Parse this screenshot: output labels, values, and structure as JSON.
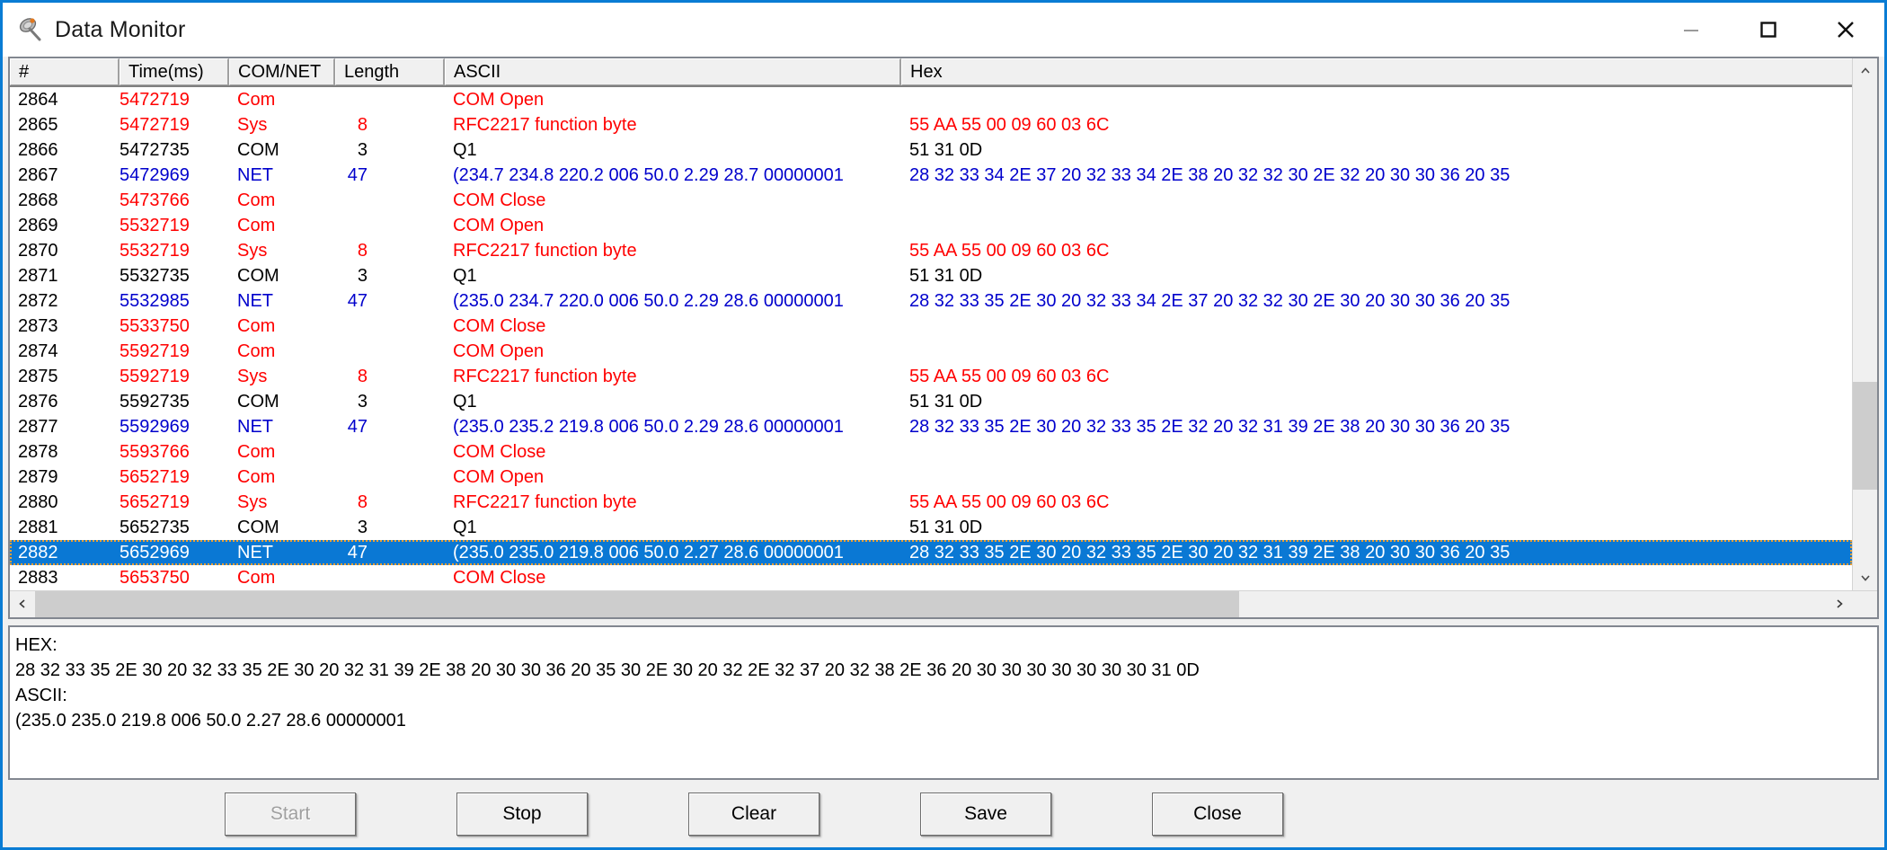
{
  "window": {
    "title": "Data Monitor",
    "icon": "satellite-dish-icon",
    "accent_color": "#0a7cd4",
    "controls": {
      "minimize": "minimize-icon",
      "maximize": "maximize-icon",
      "close": "close-icon"
    }
  },
  "colors": {
    "com_red": "#ff0000",
    "net_blue": "#0000cc",
    "normal_black": "#000000",
    "selection_blue": "#0a78d4",
    "focus_outline": "#f0a030"
  },
  "table": {
    "columns": [
      {
        "key": "num",
        "label": "#"
      },
      {
        "key": "time",
        "label": "Time(ms)"
      },
      {
        "key": "type",
        "label": "COM/NET"
      },
      {
        "key": "len",
        "label": "Length"
      },
      {
        "key": "ascii",
        "label": "ASCII"
      },
      {
        "key": "hex",
        "label": "Hex"
      }
    ],
    "rows": [
      {
        "num": "2864",
        "time": "5472719",
        "type": "Com",
        "len": "",
        "ascii": "COM Open",
        "hex": "",
        "color": "red",
        "selected": false
      },
      {
        "num": "2865",
        "time": "5472719",
        "type": "Sys",
        "len": "8",
        "ascii": "RFC2217 function byte",
        "hex": "55 AA 55 00 09 60 03 6C",
        "color": "red",
        "selected": false
      },
      {
        "num": "2866",
        "time": "5472735",
        "type": "COM",
        "len": "3",
        "ascii": "Q1",
        "hex": "51 31 0D",
        "color": "black",
        "selected": false
      },
      {
        "num": "2867",
        "time": "5472969",
        "type": "NET",
        "len": "47",
        "ascii": "(234.7 234.8 220.2 006 50.0 2.29 28.7 00000001",
        "hex": "28 32 33 34 2E 37 20 32 33 34 2E 38 20 32 32 30 2E 32 20 30 30 36 20 35",
        "color": "blue",
        "selected": false
      },
      {
        "num": "2868",
        "time": "5473766",
        "type": "Com",
        "len": "",
        "ascii": "COM Close",
        "hex": "",
        "color": "red",
        "selected": false
      },
      {
        "num": "2869",
        "time": "5532719",
        "type": "Com",
        "len": "",
        "ascii": "COM Open",
        "hex": "",
        "color": "red",
        "selected": false
      },
      {
        "num": "2870",
        "time": "5532719",
        "type": "Sys",
        "len": "8",
        "ascii": "RFC2217 function byte",
        "hex": "55 AA 55 00 09 60 03 6C",
        "color": "red",
        "selected": false
      },
      {
        "num": "2871",
        "time": "5532735",
        "type": "COM",
        "len": "3",
        "ascii": "Q1",
        "hex": "51 31 0D",
        "color": "black",
        "selected": false
      },
      {
        "num": "2872",
        "time": "5532985",
        "type": "NET",
        "len": "47",
        "ascii": "(235.0 234.7 220.0 006 50.0 2.29 28.6 00000001",
        "hex": "28 32 33 35 2E 30 20 32 33 34 2E 37 20 32 32 30 2E 30 20 30 30 36 20 35",
        "color": "blue",
        "selected": false
      },
      {
        "num": "2873",
        "time": "5533750",
        "type": "Com",
        "len": "",
        "ascii": "COM Close",
        "hex": "",
        "color": "red",
        "selected": false
      },
      {
        "num": "2874",
        "time": "5592719",
        "type": "Com",
        "len": "",
        "ascii": "COM Open",
        "hex": "",
        "color": "red",
        "selected": false
      },
      {
        "num": "2875",
        "time": "5592719",
        "type": "Sys",
        "len": "8",
        "ascii": "RFC2217 function byte",
        "hex": "55 AA 55 00 09 60 03 6C",
        "color": "red",
        "selected": false
      },
      {
        "num": "2876",
        "time": "5592735",
        "type": "COM",
        "len": "3",
        "ascii": "Q1",
        "hex": "51 31 0D",
        "color": "black",
        "selected": false
      },
      {
        "num": "2877",
        "time": "5592969",
        "type": "NET",
        "len": "47",
        "ascii": "(235.0 235.2 219.8 006 50.0 2.29 28.6 00000001",
        "hex": "28 32 33 35 2E 30 20 32 33 35 2E 32 20 32 31 39 2E 38 20 30 30 36 20 35",
        "color": "blue",
        "selected": false
      },
      {
        "num": "2878",
        "time": "5593766",
        "type": "Com",
        "len": "",
        "ascii": "COM Close",
        "hex": "",
        "color": "red",
        "selected": false
      },
      {
        "num": "2879",
        "time": "5652719",
        "type": "Com",
        "len": "",
        "ascii": "COM Open",
        "hex": "",
        "color": "red",
        "selected": false
      },
      {
        "num": "2880",
        "time": "5652719",
        "type": "Sys",
        "len": "8",
        "ascii": "RFC2217 function byte",
        "hex": "55 AA 55 00 09 60 03 6C",
        "color": "red",
        "selected": false
      },
      {
        "num": "2881",
        "time": "5652735",
        "type": "COM",
        "len": "3",
        "ascii": "Q1",
        "hex": "51 31 0D",
        "color": "black",
        "selected": false
      },
      {
        "num": "2882",
        "time": "5652969",
        "type": "NET",
        "len": "47",
        "ascii": "(235.0 235.0 219.8 006 50.0 2.27 28.6 00000001",
        "hex": "28 32 33 35 2E 30 20 32 33 35 2E 30 20 32 31 39 2E 38 20 30 30 36 20 35",
        "color": "blue",
        "selected": true
      },
      {
        "num": "2883",
        "time": "5653750",
        "type": "Com",
        "len": "",
        "ascii": "COM Close",
        "hex": "",
        "color": "red",
        "selected": false
      }
    ]
  },
  "detail": {
    "hex_label": "HEX:",
    "hex_value": "28 32 33 35 2E 30 20 32 33 35 2E 30 20 32 31 39 2E 38 20 30 30 36 20 35 30 2E 30 20 32 2E 32 37 20 32 38 2E 36 20 30 30 30 30 30 30 30 31 0D",
    "ascii_label": "ASCII:",
    "ascii_value": "(235.0 235.0 219.8 006 50.0 2.27 28.6 00000001"
  },
  "buttons": [
    {
      "name": "start-button",
      "label": "Start",
      "disabled": true
    },
    {
      "name": "stop-button",
      "label": "Stop",
      "disabled": false
    },
    {
      "name": "clear-button",
      "label": "Clear",
      "disabled": false
    },
    {
      "name": "save-button",
      "label": "Save",
      "disabled": false
    },
    {
      "name": "close-button",
      "label": "Close",
      "disabled": false
    }
  ],
  "scrollbars": {
    "vertical": {
      "up_arrow": "chevron-up-icon",
      "down_arrow": "chevron-down-icon"
    },
    "horizontal": {
      "left_arrow": "chevron-left-icon",
      "right_arrow": "chevron-right-icon"
    }
  }
}
